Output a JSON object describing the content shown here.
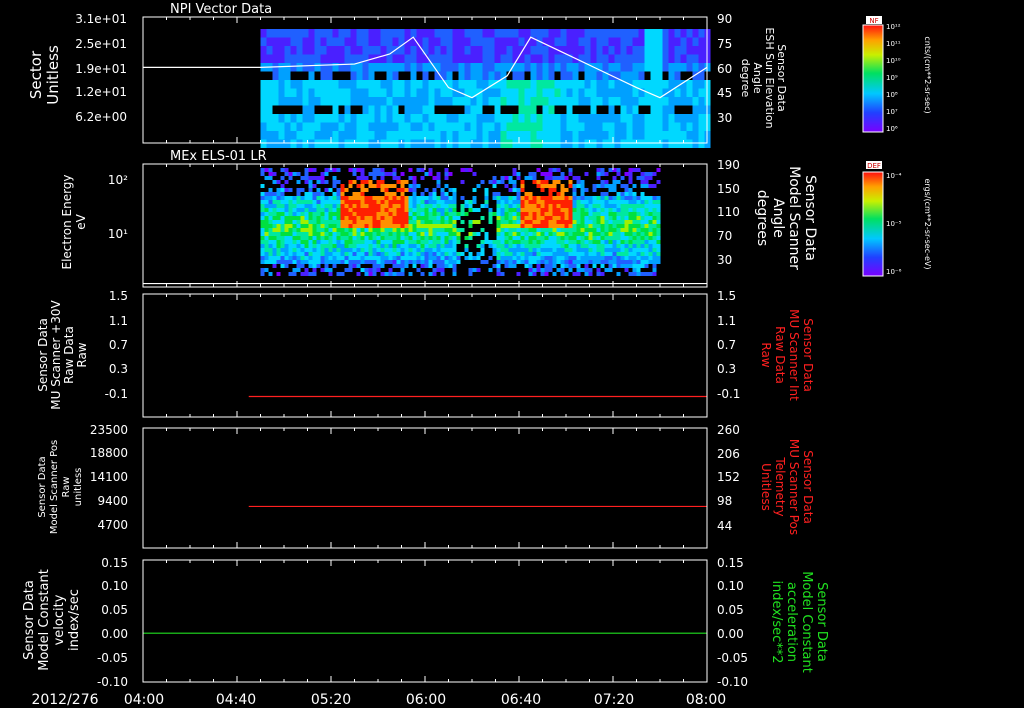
{
  "colors": {
    "white": "#ffffff",
    "red": "#ff2020",
    "green": "#20e020",
    "frame": "#ffffff"
  },
  "xaxis": {
    "date": "2012/276",
    "ticks": [
      "04:00",
      "04:40",
      "05:20",
      "06:00",
      "06:40",
      "07:20",
      "08:00"
    ]
  },
  "panel1": {
    "title": "NPI Vector Data",
    "left_label": [
      "Sector",
      "Unitless"
    ],
    "right_label": [
      "Sensor Data",
      "ESH Sun Elevation",
      "Angle",
      "degree"
    ],
    "left_ticks": [
      "3.1e+01",
      "2.5e+01",
      "1.9e+01",
      "1.2e+01",
      "6.2e+00"
    ],
    "right_ticks": [
      "90",
      "75",
      "60",
      "45",
      "30"
    ],
    "colorbar_label": "NF",
    "colorbar_unit": "cnts/(cm**2-sr-sec)",
    "colorbar_ticks": [
      "10¹²",
      "10¹¹",
      "10¹⁰",
      "10⁹",
      "10⁸",
      "10⁷",
      "10⁶"
    ]
  },
  "panel2": {
    "title": "MEx ELS-01 LR",
    "left_label": [
      "Electron Energy",
      "eV"
    ],
    "right_label": [
      "Sensor Data",
      "Model Scanner",
      "Angle",
      "degrees"
    ],
    "left_ticks": [
      "10²",
      "10¹"
    ],
    "right_ticks": [
      "190",
      "150",
      "110",
      "70",
      "30"
    ],
    "colorbar_label": "DEF",
    "colorbar_unit": "ergs/(cm**2-sr-sec-eV)",
    "colorbar_ticks": [
      "10⁻⁴",
      "10⁻⁵",
      "10⁻⁶"
    ]
  },
  "panel3": {
    "left_label": [
      "Sensor Data",
      "MU Scanner +30V",
      "Raw Data",
      "Raw"
    ],
    "right_label": [
      "Sensor Data",
      "MU Scanner Int",
      "Raw Data",
      "Raw"
    ],
    "left_ticks": [
      "1.5",
      "1.1",
      "0.7",
      "0.3",
      "-0.1"
    ],
    "right_ticks": [
      "1.5",
      "1.1",
      "0.7",
      "0.3",
      "-0.1"
    ]
  },
  "panel4": {
    "left_label": [
      "Sensor Data",
      "Model Scanner Pos",
      "Raw",
      "unitless"
    ],
    "right_label": [
      "Sensor Data",
      "MU Scanner Pos",
      "Telemetry",
      "Unitless"
    ],
    "left_ticks": [
      "23500",
      "18800",
      "14100",
      "9400",
      "4700"
    ],
    "right_ticks": [
      "260",
      "206",
      "152",
      "98",
      "44"
    ]
  },
  "panel5": {
    "left_label": [
      "Sensor Data",
      "Model Constant",
      "velocity",
      "index/sec"
    ],
    "right_label": [
      "Sensor Data",
      "Model Constant",
      "acceleration",
      "index/sec**2"
    ],
    "left_ticks": [
      "0.15",
      "0.10",
      "0.05",
      "0.00",
      "-0.05",
      "-0.10"
    ],
    "right_ticks": [
      "0.15",
      "0.10",
      "0.05",
      "0.00",
      "-0.05",
      "-0.10"
    ]
  },
  "chart_data": [
    {
      "type": "heatmap",
      "title": "NPI Vector Data",
      "ylabel": "Sector Unitless",
      "y2label": "Sensor Data ESH Sun Elevation Angle degree",
      "xlim": [
        "04:00",
        "08:00"
      ],
      "ylim": [
        0,
        31
      ],
      "y2lim": [
        15,
        90
      ],
      "data_start": "04:50",
      "series": [
        {
          "name": "ESH Sun Elevation",
          "x": [
            "04:00",
            "04:50",
            "05:30",
            "05:45",
            "05:55",
            "06:10",
            "06:20",
            "06:35",
            "06:45",
            "07:00",
            "07:15",
            "07:30",
            "07:40",
            "08:00"
          ],
          "values": [
            60,
            60,
            62,
            68,
            78,
            48,
            42,
            55,
            78,
            68,
            58,
            48,
            42,
            60
          ]
        }
      ]
    },
    {
      "type": "heatmap",
      "title": "MEx ELS-01 LR",
      "ylabel": "Electron Energy eV",
      "y2label": "Sensor Data Model Scanner Angle degrees",
      "xlim": [
        "04:00",
        "08:00"
      ],
      "y2lim": [
        10,
        190
      ],
      "yscale": "log",
      "data_start": "04:50",
      "data_end": "07:40",
      "series": [
        {
          "name": "Model Scanner Angle",
          "x": [
            "04:00",
            "08:00"
          ],
          "values": [
            15,
            15
          ]
        }
      ]
    },
    {
      "type": "line",
      "ylabel": "Sensor Data MU Scanner +30V Raw Data Raw",
      "y2label": "Sensor Data MU Scanner Int Raw Data Raw",
      "xlim": [
        "04:00",
        "08:00"
      ],
      "ylim": [
        -0.3,
        1.5
      ],
      "series": [
        {
          "name": "MU Scanner Int",
          "x": [
            "04:45",
            "08:00"
          ],
          "values": [
            0,
            0
          ]
        }
      ]
    },
    {
      "type": "line",
      "ylabel": "Sensor Data Model Scanner Pos Raw unitless",
      "y2label": "Sensor Data MU Scanner Pos Telemetry Unitless",
      "xlim": [
        "04:00",
        "08:00"
      ],
      "ylim": [
        0,
        23500
      ],
      "y2lim": [
        0,
        260
      ],
      "series": [
        {
          "name": "MU Scanner Pos",
          "x": [
            "04:45",
            "08:00"
          ],
          "values": [
            90,
            90
          ]
        }
      ]
    },
    {
      "type": "line",
      "ylabel": "Sensor Data Model Constant velocity index/sec",
      "y2label": "Sensor Data Model Constant acceleration index/sec**2",
      "xlim": [
        "04:00",
        "08:00"
      ],
      "ylim": [
        -0.1,
        0.15
      ],
      "series": [
        {
          "name": "Model Constant acceleration",
          "x": [
            "04:00",
            "08:00"
          ],
          "values": [
            0,
            0
          ]
        }
      ]
    }
  ]
}
